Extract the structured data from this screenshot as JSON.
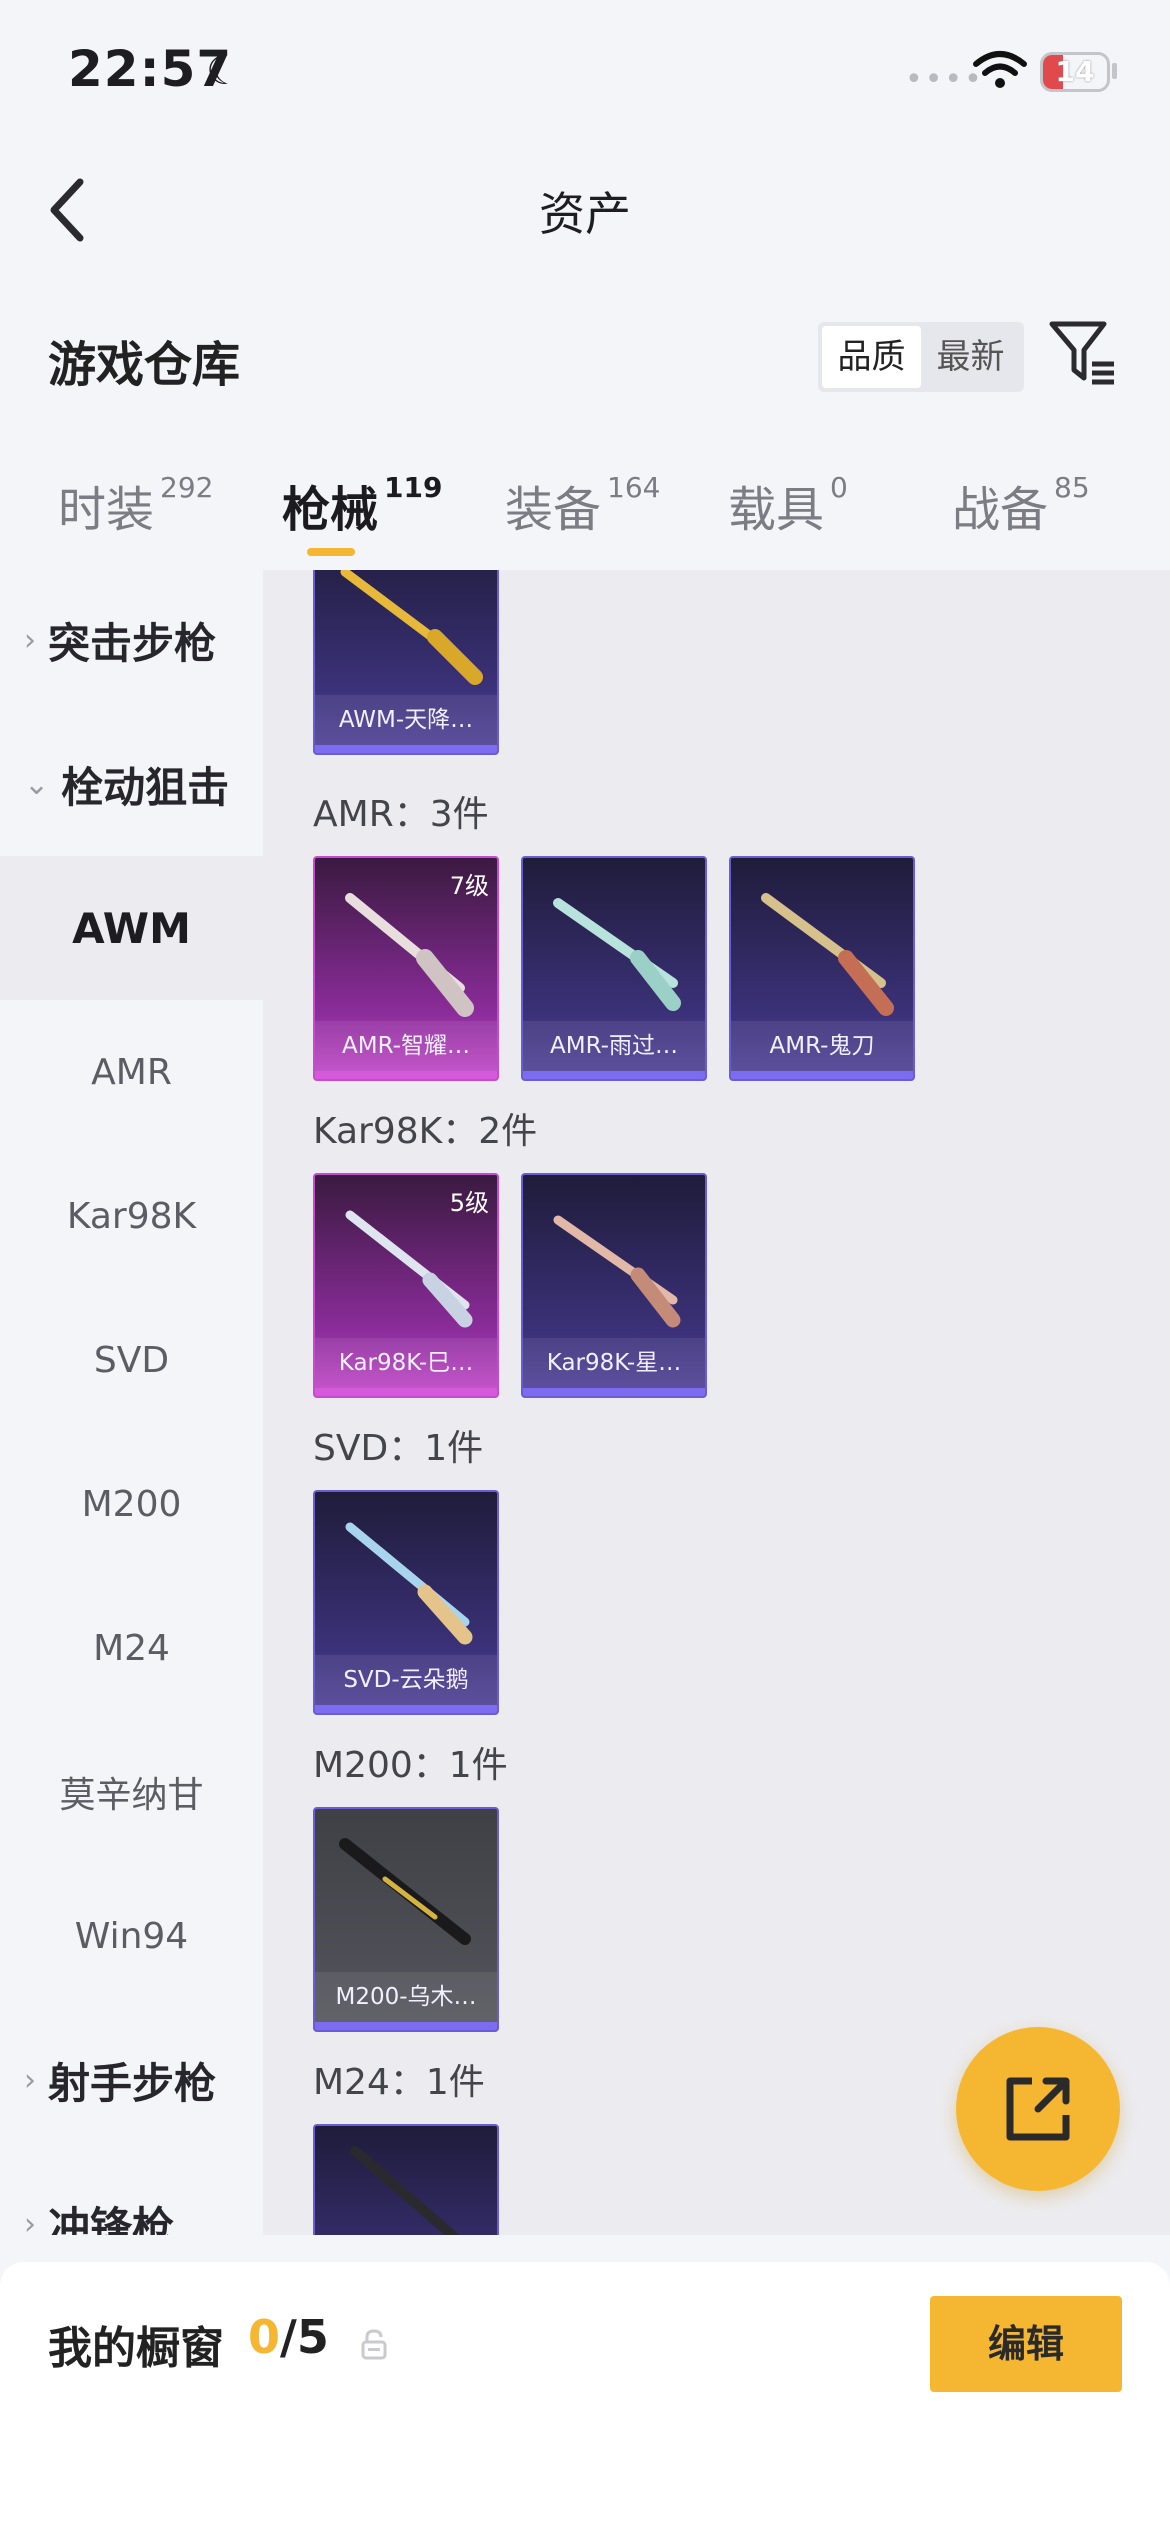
{
  "status": {
    "time": "22:57",
    "battery": "14"
  },
  "nav": {
    "title": "资产"
  },
  "section": {
    "title": "游戏仓库",
    "sort_quality": "品质",
    "sort_latest": "最新"
  },
  "tabs": [
    {
      "label": "时装",
      "count": "292"
    },
    {
      "label": "枪械",
      "count": "119"
    },
    {
      "label": "装备",
      "count": "164"
    },
    {
      "label": "载具",
      "count": "0"
    },
    {
      "label": "战备",
      "count": "85"
    }
  ],
  "sidebar": {
    "items": [
      {
        "label": "突击步枪",
        "chevron": "›"
      },
      {
        "label": "栓动狙击",
        "chevron": "⌄"
      },
      {
        "label": "AWM"
      },
      {
        "label": "AMR"
      },
      {
        "label": "Kar98K"
      },
      {
        "label": "SVD"
      },
      {
        "label": "M200"
      },
      {
        "label": "M24"
      },
      {
        "label": "莫辛纳甘"
      },
      {
        "label": "Win94"
      },
      {
        "label": "射手步枪",
        "chevron": "›"
      },
      {
        "label": "冲锋枪",
        "chevron": "›"
      }
    ]
  },
  "content": {
    "awm_cards": [
      {
        "name": "AWM-天降…"
      }
    ],
    "amr_label": "AMR：3件",
    "amr_cards": [
      {
        "name": "AMR-智耀…",
        "level": "7级"
      },
      {
        "name": "AMR-雨过…"
      },
      {
        "name": "AMR-鬼刀"
      }
    ],
    "kar_label": "Kar98K：2件",
    "kar_cards": [
      {
        "name": "Kar98K-巳…",
        "level": "5级"
      },
      {
        "name": "Kar98K-星…"
      }
    ],
    "svd_label": "SVD：1件",
    "svd_cards": [
      {
        "name": "SVD-云朵鹅"
      }
    ],
    "m200_label": "M200：1件",
    "m200_cards": [
      {
        "name": "M200-乌木…"
      }
    ],
    "m24_label": "M24：1件"
  },
  "showcase": {
    "title": "我的橱窗",
    "current": "0",
    "total": "/5",
    "edit_label": "编辑"
  }
}
